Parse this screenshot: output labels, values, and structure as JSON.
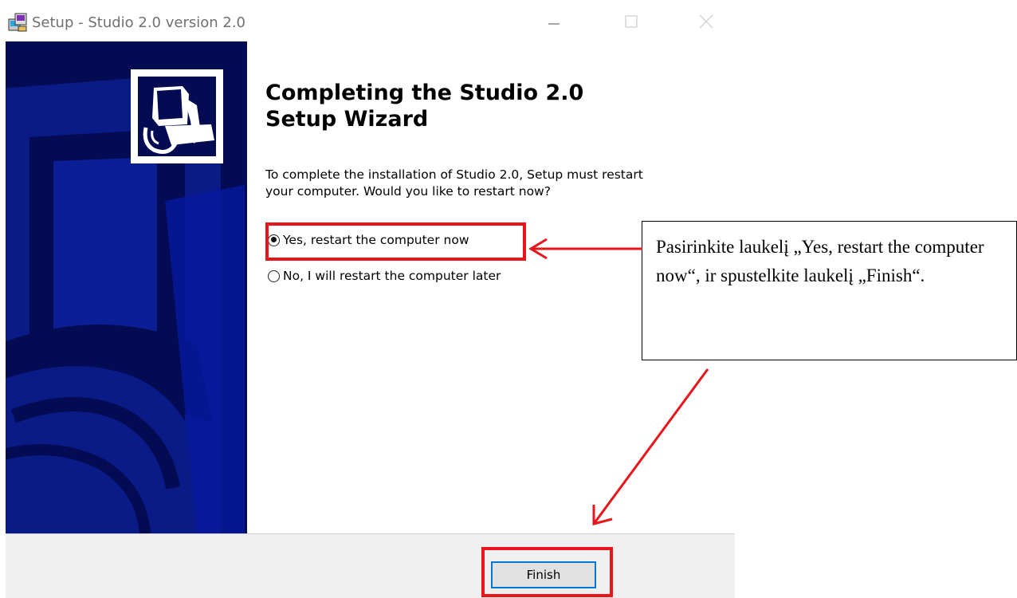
{
  "window": {
    "title": "Setup - Studio 2.0 version 2.0",
    "controls": [
      "minimize",
      "maximize",
      "close"
    ]
  },
  "wizard": {
    "heading_line1": "Completing the Studio 2.0",
    "heading_line2": "Setup Wizard",
    "description_line1": "To complete the installation of Studio 2.0, Setup must restart",
    "description_line2": "your computer. Would you like to restart now?",
    "options": [
      {
        "label": "Yes, restart the computer now",
        "selected": true
      },
      {
        "label": "No, I will restart the computer later",
        "selected": false
      }
    ],
    "finish_label": "Finish"
  },
  "annotation": {
    "callout_text": "Pasirinkite laukelį „Yes, restart the computer now“, ir spustelkite laukelį „Finish“.",
    "highlight_color": "#e8151b"
  },
  "colors": {
    "banner": "#030b52",
    "focus_border": "#0078d7",
    "bottom_panel": "#f0f0f0"
  }
}
